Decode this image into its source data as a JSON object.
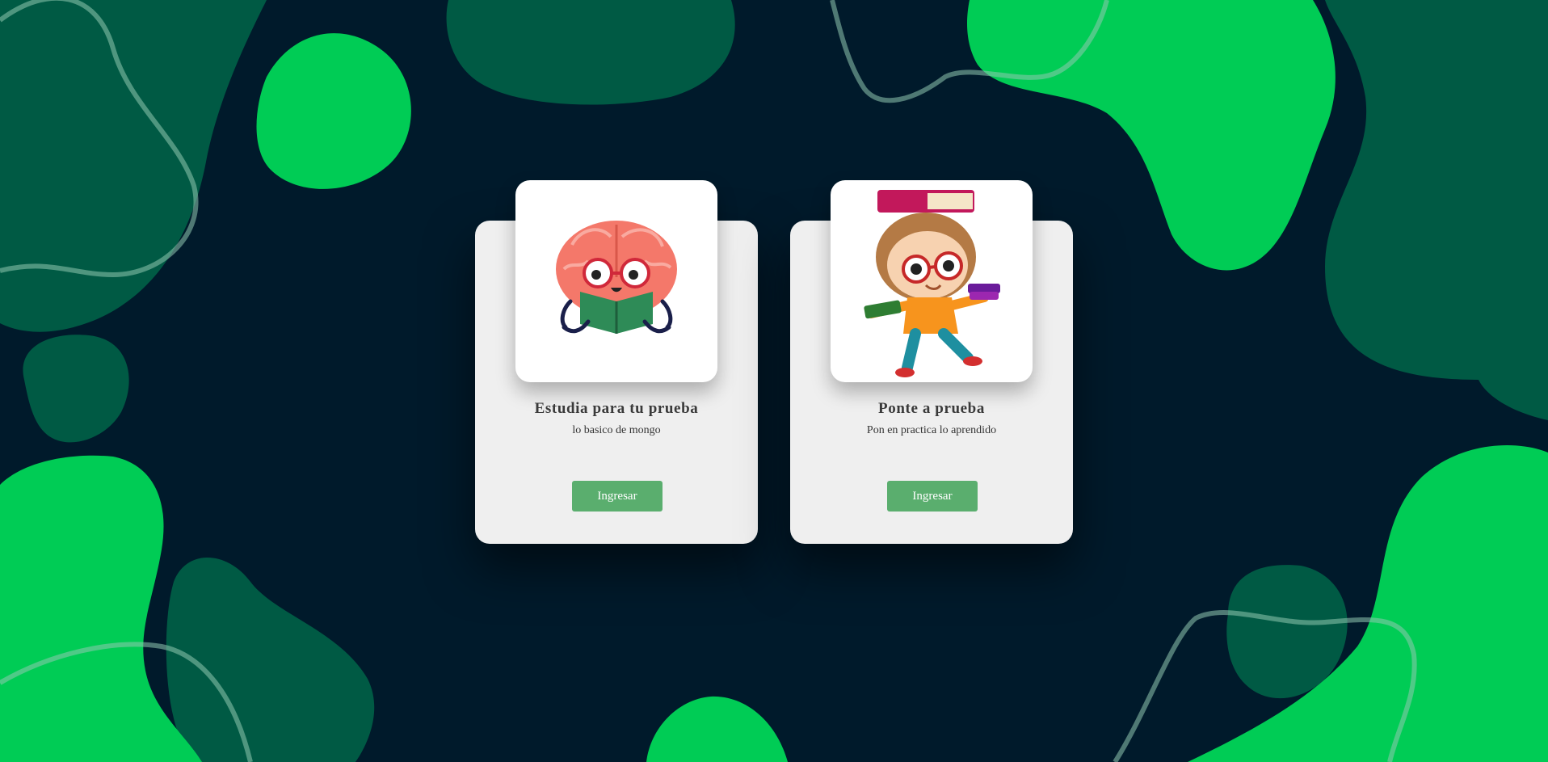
{
  "cards": [
    {
      "title": "Estudia para tu prueba",
      "subtitle": "lo basico de mongo",
      "button_label": "Ingresar",
      "image": "brain-reading-book-illustration"
    },
    {
      "title": "Ponte a prueba",
      "subtitle": "Pon en practica lo aprendido",
      "button_label": "Ingresar",
      "image": "boy-carrying-books-illustration"
    }
  ],
  "colors": {
    "background": "#001a2b",
    "blob_bright": "#00cc55",
    "blob_dark": "#005a44",
    "card": "#efefef",
    "button": "#5aae6e"
  }
}
